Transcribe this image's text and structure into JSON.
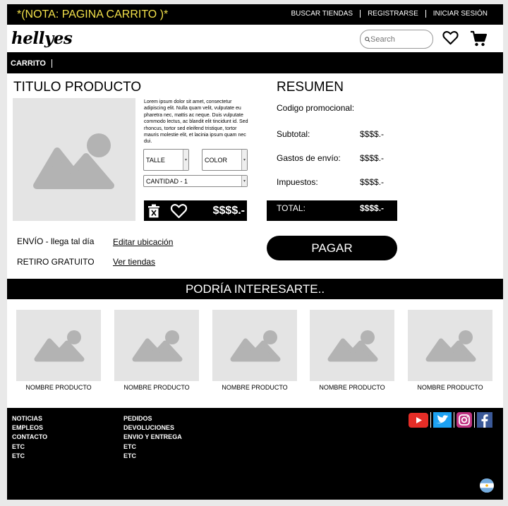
{
  "top_bar": {
    "note": "*(NOTA: PAGINA CARRITO )*",
    "links": [
      "BUSCAR TIENDAS",
      "REGISTRARSE",
      "INICIAR SESIÓN"
    ]
  },
  "header": {
    "logo": "hellyes",
    "search_placeholder": "Search"
  },
  "breadcrumb": "CARRITO",
  "product": {
    "title": "TITULO PRODUCTO",
    "description": "Lorem ipsum dolor sit amet, consectetur adipiscing elit. Nulla quam velit, vulputate eu pharetra nec, mattis ac neque. Duis vulputate commodo lectus, ac blandit elit tincidunt id. Sed rhoncus, tortor sed eleifend tristique, tortor mauris molestie elit, et lacinia ipsum quam nec dui.",
    "size_select": "TALLE",
    "color_select": "COLOR",
    "quantity_select": "CANTIDAD - 1",
    "price": "$$$$.-"
  },
  "shipping": {
    "envio_label": "ENVÍO - llega tal día",
    "envio_link": "Editar ubicación",
    "retiro_label": "RETIRO GRATUITO",
    "retiro_link": "Ver tiendas"
  },
  "summary": {
    "title": "RESUMEN",
    "promo_label": "Codigo promocional:",
    "subtotal_label": "Subtotal:",
    "subtotal_value": "$$$$.-",
    "shipping_label": "Gastos de envío:",
    "shipping_value": "$$$$.-",
    "tax_label": "Impuestos:",
    "tax_value": "$$$$.-",
    "total_label": "TOTAL:",
    "total_value": "$$$$.-",
    "pay_button": "PAGAR"
  },
  "interest": {
    "title": "PODRÍA INTERESARTE..",
    "products": [
      "NOMBRE PRODUCTO",
      "NOMBRE PRODUCTO",
      "NOMBRE PRODUCTO",
      "NOMBRE PRODUCTO",
      "NOMBRE PRODUCTO"
    ]
  },
  "footer": {
    "col1": [
      "NOTICIAS",
      "EMPLEOS",
      "CONTACTO",
      "ETC",
      "ETC"
    ],
    "col2": [
      "PEDIDOS",
      "DEVOLUCIONES",
      "ENVIO Y ENTREGA",
      "ETC",
      "ETC"
    ],
    "socials": [
      "youtube-icon",
      "twitter-icon",
      "instagram-icon",
      "facebook-icon"
    ]
  },
  "colors": {
    "note_text": "#f2e04a",
    "placeholder_bg": "#e4e4e4",
    "placeholder_shape": "#b3b3b3",
    "youtube": "#e52d27",
    "twitter": "#1da1f2",
    "facebook": "#3b5998",
    "instagram": "#c13584",
    "flag_blue": "#74acdf"
  }
}
